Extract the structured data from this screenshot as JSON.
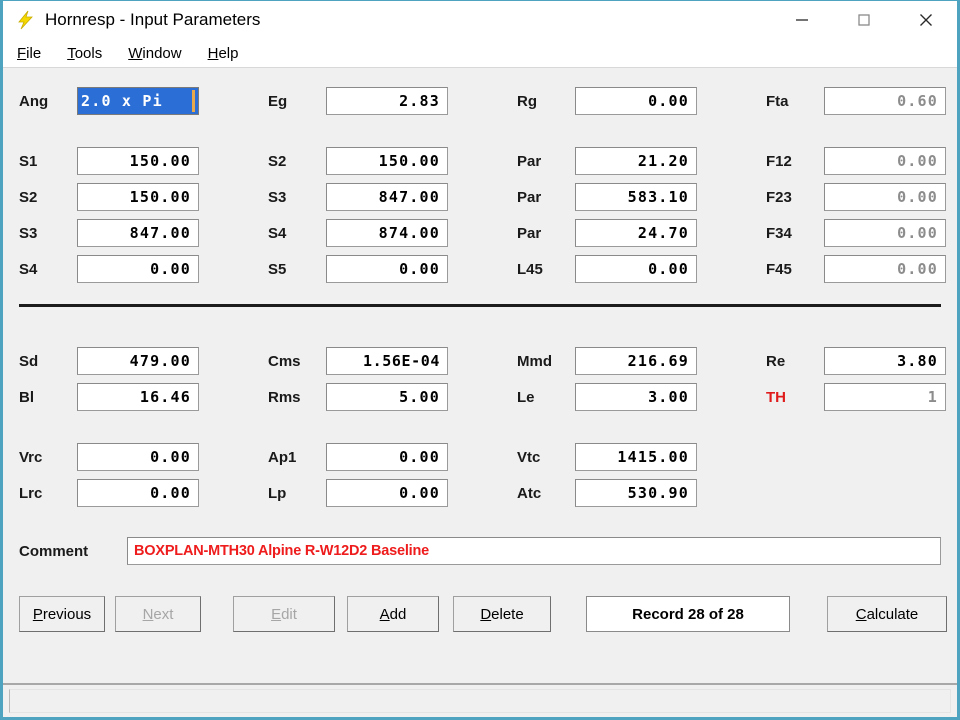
{
  "window": {
    "title": "Hornresp - Input Parameters",
    "icon": "lightning-bolt-icon",
    "minimize_label": "—",
    "maximize_label": "□",
    "close_label": "✕"
  },
  "menu": {
    "items": [
      {
        "label": "File",
        "accel": "F"
      },
      {
        "label": "Tools",
        "accel": "T"
      },
      {
        "label": "Window",
        "accel": "W"
      },
      {
        "label": "Help",
        "accel": "H"
      }
    ]
  },
  "fields": {
    "ang": {
      "label": "Ang",
      "value": "2.0 x Pi",
      "state": "selected"
    },
    "eg": {
      "label": "Eg",
      "value": "2.83",
      "state": "enabled"
    },
    "rg": {
      "label": "Rg",
      "value": "0.00",
      "state": "enabled"
    },
    "fta": {
      "label": "Fta",
      "value": "0.60",
      "state": "disabled"
    },
    "s1": {
      "label": "S1",
      "value": "150.00",
      "state": "enabled"
    },
    "s2r": {
      "label": "S2",
      "value": "150.00",
      "state": "enabled"
    },
    "par1": {
      "label": "Par",
      "value": "21.20",
      "state": "enabled"
    },
    "f12": {
      "label": "F12",
      "value": "0.00",
      "state": "disabled"
    },
    "s2": {
      "label": "S2",
      "value": "150.00",
      "state": "enabled"
    },
    "s3r": {
      "label": "S3",
      "value": "847.00",
      "state": "enabled"
    },
    "par2": {
      "label": "Par",
      "value": "583.10",
      "state": "enabled"
    },
    "f23": {
      "label": "F23",
      "value": "0.00",
      "state": "disabled"
    },
    "s3": {
      "label": "S3",
      "value": "847.00",
      "state": "enabled"
    },
    "s4r": {
      "label": "S4",
      "value": "874.00",
      "state": "enabled"
    },
    "par3": {
      "label": "Par",
      "value": "24.70",
      "state": "enabled"
    },
    "f34": {
      "label": "F34",
      "value": "0.00",
      "state": "disabled"
    },
    "s4": {
      "label": "S4",
      "value": "0.00",
      "state": "enabled"
    },
    "s5": {
      "label": "S5",
      "value": "0.00",
      "state": "enabled"
    },
    "l45": {
      "label": "L45",
      "value": "0.00",
      "state": "enabled"
    },
    "f45": {
      "label": "F45",
      "value": "0.00",
      "state": "disabled"
    },
    "sd": {
      "label": "Sd",
      "value": "479.00",
      "state": "enabled"
    },
    "cms": {
      "label": "Cms",
      "value": "1.56E-04",
      "state": "enabled"
    },
    "mmd": {
      "label": "Mmd",
      "value": "216.69",
      "state": "enabled"
    },
    "re": {
      "label": "Re",
      "value": "3.80",
      "state": "enabled"
    },
    "bl": {
      "label": "Bl",
      "value": "16.46",
      "state": "enabled"
    },
    "rms": {
      "label": "Rms",
      "value": "5.00",
      "state": "enabled"
    },
    "le": {
      "label": "Le",
      "value": "3.00",
      "state": "enabled"
    },
    "th": {
      "label": "TH",
      "value": "1",
      "state": "disabled"
    },
    "vrc": {
      "label": "Vrc",
      "value": "0.00",
      "state": "enabled"
    },
    "ap1": {
      "label": "Ap1",
      "value": "0.00",
      "state": "enabled"
    },
    "vtc": {
      "label": "Vtc",
      "value": "1415.00",
      "state": "enabled"
    },
    "lrc": {
      "label": "Lrc",
      "value": "0.00",
      "state": "enabled"
    },
    "lp": {
      "label": "Lp",
      "value": "0.00",
      "state": "enabled"
    },
    "atc": {
      "label": "Atc",
      "value": "530.90",
      "state": "enabled"
    }
  },
  "comment": {
    "label": "Comment",
    "value": "BOXPLAN-MTH30 Alpine R-W12D2 Baseline",
    "color": "#ee1c1c"
  },
  "buttons": {
    "previous": {
      "label": "Previous",
      "accel": "P",
      "state": "enabled"
    },
    "next": {
      "label": "Next",
      "accel": "N",
      "state": "disabled"
    },
    "edit": {
      "label": "Edit",
      "accel": "E",
      "state": "disabled"
    },
    "add": {
      "label": "Add",
      "accel": "A",
      "state": "enabled"
    },
    "delete": {
      "label": "Delete",
      "accel": "D",
      "state": "enabled"
    },
    "record": {
      "label": "Record 28 of 28",
      "state": "enabled"
    },
    "calculate": {
      "label": "Calculate",
      "accel": "C",
      "state": "enabled"
    }
  },
  "statusbar": {
    "text": ""
  },
  "colors": {
    "window_border": "#4ea3c0",
    "client_bg": "#f0f0f0",
    "selection_blue": "#2b6ed6",
    "comment_red": "#ee1c1c",
    "label_red": "#e01b1b",
    "disabled_text": "#8c8c8c"
  }
}
